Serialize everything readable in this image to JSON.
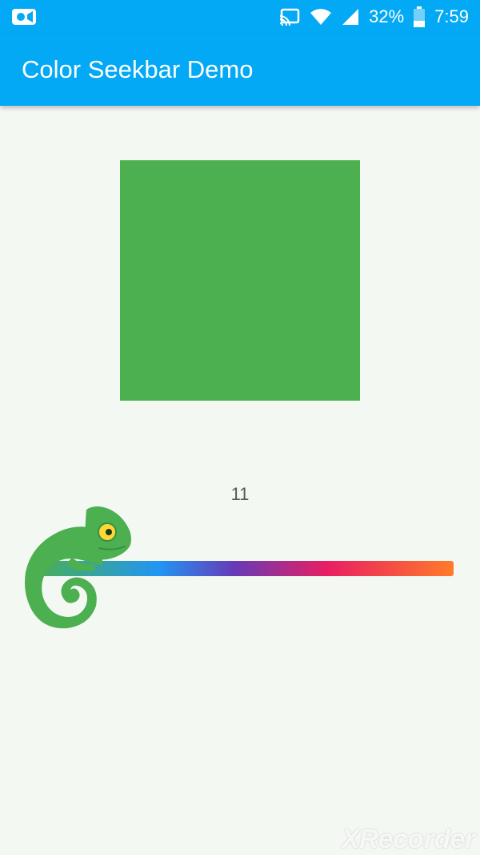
{
  "status_bar": {
    "battery_text": "32%",
    "time": "7:59",
    "icons": [
      "video-recording-icon",
      "cast-icon",
      "wifi-icon",
      "signal-icon",
      "battery-icon"
    ]
  },
  "app_bar": {
    "title": "Color Seekbar Demo",
    "color": "#03a9f4"
  },
  "preview": {
    "color": "#4caf50"
  },
  "seekbar": {
    "value": "11",
    "gradient_colors": [
      "#4caf50",
      "#2196f3",
      "#673ab7",
      "#e91e63",
      "#ff7b29"
    ],
    "thumb_icon": "chameleon-icon"
  },
  "watermark": {
    "text": "XRecorder"
  }
}
